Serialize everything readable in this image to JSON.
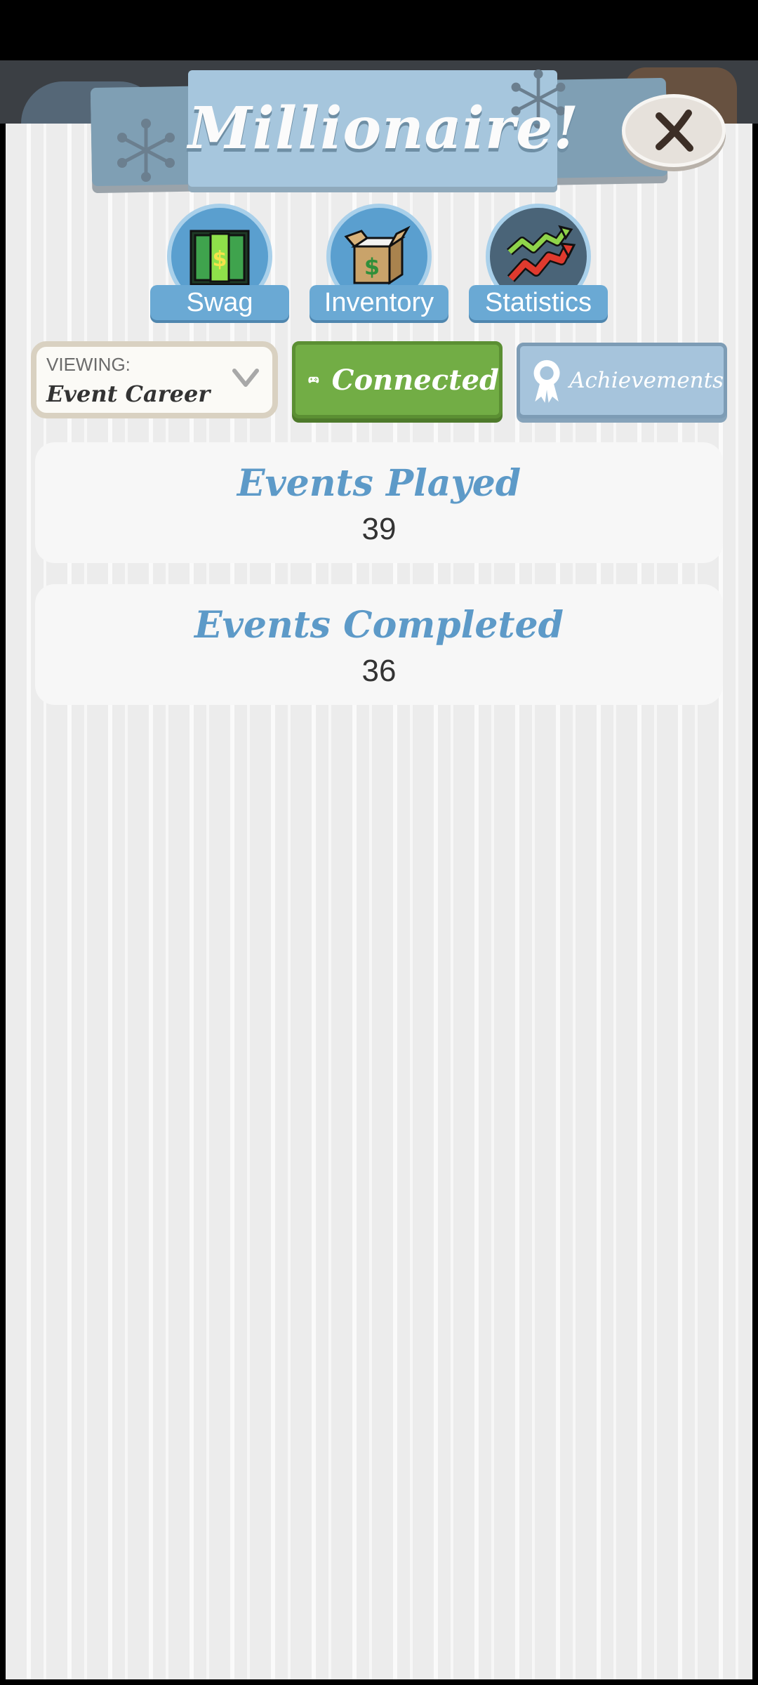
{
  "header": {
    "title": "Millionaire!",
    "close_label": "X"
  },
  "nav": {
    "items": [
      {
        "label": "Swag",
        "icon": "cash-door-icon"
      },
      {
        "label": "Inventory",
        "icon": "money-box-icon"
      },
      {
        "label": "Statistics",
        "icon": "trend-arrows-icon"
      }
    ]
  },
  "viewing": {
    "caption": "VIEWING:",
    "value": "Event Career"
  },
  "buttons": {
    "connected_label": "Connected",
    "achievements_label": "Achievements"
  },
  "stats": [
    {
      "label": "Events Played",
      "value": "39"
    },
    {
      "label": "Events Completed",
      "value": "36"
    }
  ],
  "colors": {
    "accent_blue": "#5d9ac8",
    "connected_green": "#72ad45",
    "banner_blue": "#a6c6dd"
  }
}
